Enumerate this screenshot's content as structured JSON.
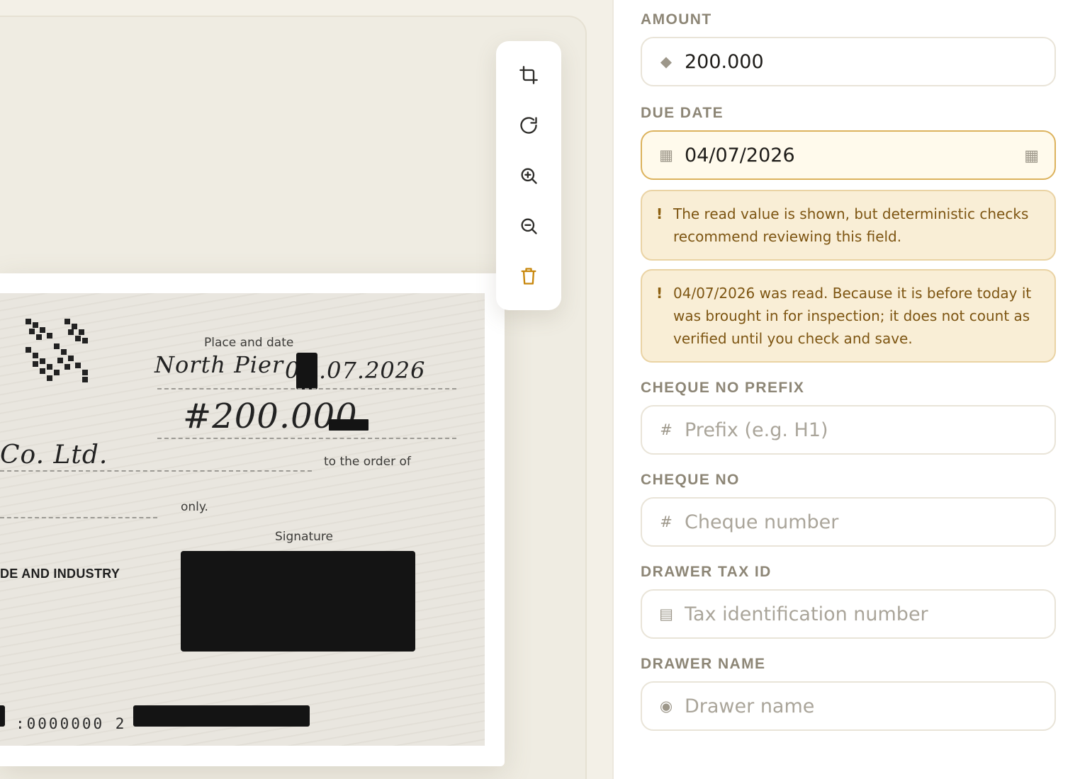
{
  "cheque": {
    "place_label": "Place and date",
    "place_value": "North Pier",
    "date_prefix": "0",
    "date_rest": ".07.2026",
    "amount_value": "#200.000",
    "payee_fragment": "Co. Ltd.",
    "order_label": "to the order of",
    "only_label": "only.",
    "signature_label": "Signature",
    "bank_fragment": "DE AND INDUSTRY",
    "micr_text": ":0000000 2"
  },
  "toolbar": {
    "items": [
      {
        "icon": "crop-icon"
      },
      {
        "icon": "rotate-icon"
      },
      {
        "icon": "zoom-in-icon"
      },
      {
        "icon": "zoom-out-icon"
      },
      {
        "icon": "trash-icon"
      }
    ]
  },
  "form": {
    "amount": {
      "label": "AMOUNT",
      "value": "200.000",
      "icon": "diamond-icon"
    },
    "due_date": {
      "label": "DUE DATE",
      "value": "04/07/2026",
      "icon": "calendar-icon"
    },
    "warnings": [
      "The read value is shown, but deterministic checks recommend reviewing this field.",
      "04/07/2026 was read. Because it is before today it was brought in for inspection; it does not count as verified until you check and save."
    ],
    "cheque_prefix": {
      "label": "CHEQUE NO PREFIX",
      "placeholder": "Prefix (e.g. H1)",
      "icon": "hash-icon"
    },
    "cheque_no": {
      "label": "CHEQUE NO",
      "placeholder": "Cheque number",
      "icon": "hash-icon"
    },
    "drawer_tax_id": {
      "label": "DRAWER TAX ID",
      "placeholder": "Tax identification number",
      "icon": "id-card-icon"
    },
    "drawer_name": {
      "label": "DRAWER NAME",
      "placeholder": "Drawer name",
      "icon": "person-icon"
    }
  },
  "colors": {
    "accent": "#c8870c",
    "warning_bg": "#f9eed6",
    "warning_text": "#7d5512",
    "highlight_border": "#dcb25c"
  }
}
